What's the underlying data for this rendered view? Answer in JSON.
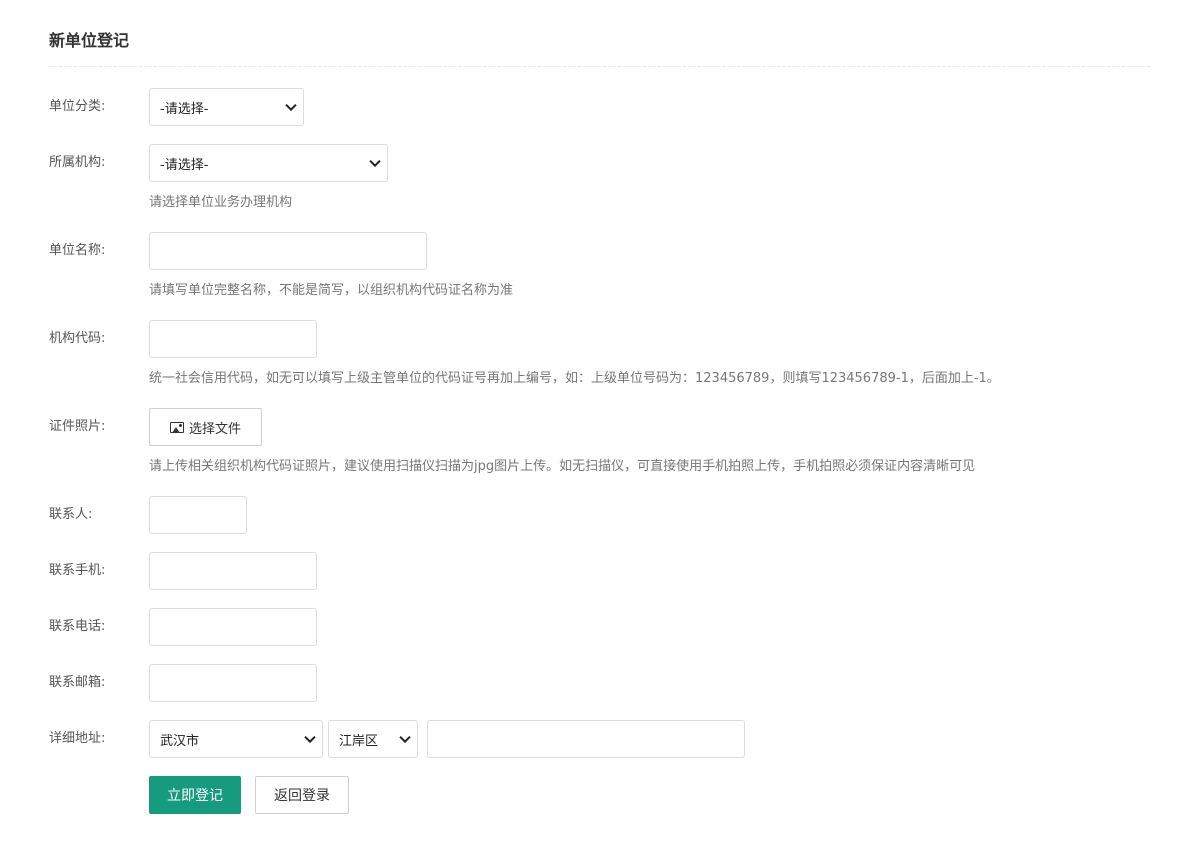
{
  "page": {
    "title": "新单位登记"
  },
  "form": {
    "category": {
      "label": "单位分类:",
      "selected": "-请选择-"
    },
    "org": {
      "label": "所属机构:",
      "selected": "-请选择-",
      "help": "请选择单位业务办理机构"
    },
    "unit_name": {
      "label": "单位名称:",
      "value": "",
      "help": "请填写单位完整名称，不能是简写，以组织机构代码证名称为准"
    },
    "org_code": {
      "label": "机构代码:",
      "value": "",
      "help": "统一社会信用代码，如无可以填写上级主管单位的代码证号再加上编号，如：上级单位号码为：123456789，则填写123456789-1，后面加上-1。"
    },
    "certificate": {
      "label": "证件照片:",
      "button_label": "选择文件",
      "icon": "image-icon",
      "help": "请上传相关组织机构代码证照片，建议使用扫描仪扫描为jpg图片上传。如无扫描仪，可直接使用手机拍照上传，手机拍照必须保证内容清晰可见"
    },
    "contact": {
      "label": "联系人:",
      "value": ""
    },
    "mobile": {
      "label": "联系手机:",
      "value": ""
    },
    "phone": {
      "label": "联系电话:",
      "value": ""
    },
    "email": {
      "label": "联系邮箱:",
      "value": ""
    },
    "address": {
      "label": "详细地址:",
      "city": "武汉市",
      "district": "江岸区",
      "detail": ""
    }
  },
  "actions": {
    "submit_label": "立即登记",
    "back_label": "返回登录"
  },
  "colors": {
    "primary": "#169b7e",
    "border": "#dcdcdc",
    "help_text": "#777777"
  }
}
